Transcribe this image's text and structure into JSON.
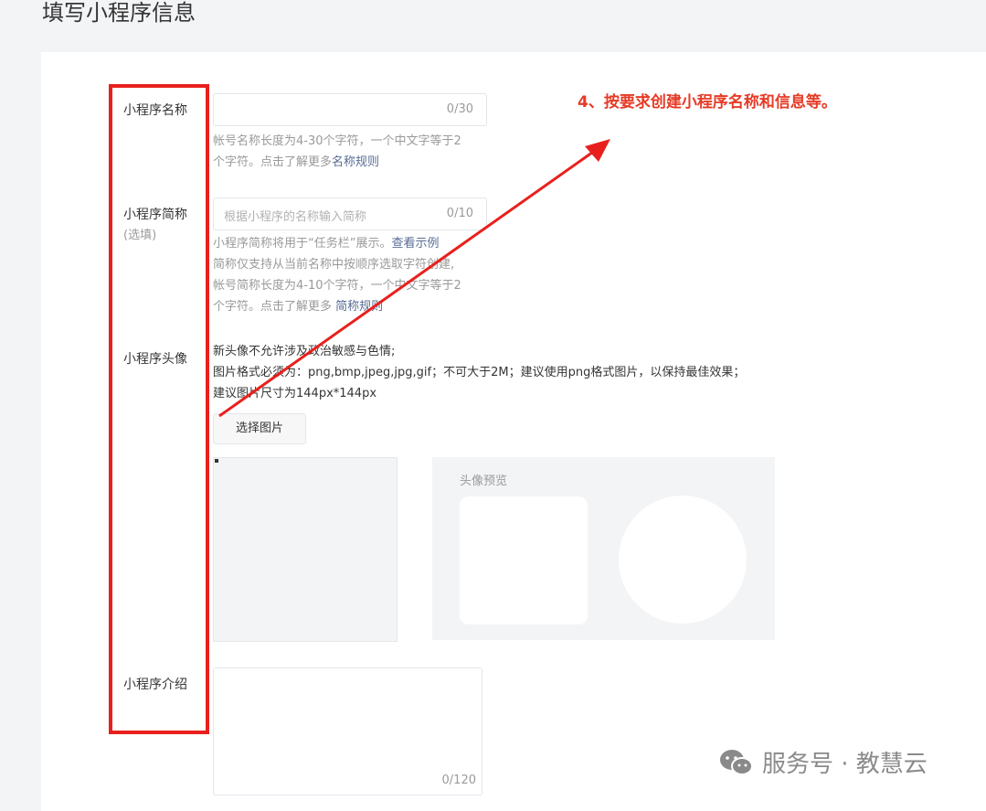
{
  "page": {
    "title": "填写小程序信息"
  },
  "form": {
    "name": {
      "label": "小程序名称",
      "counter": "0/30",
      "tip_text": "帐号名称长度为4-30个字符，一个中文字等于2个字符。点击了解更多",
      "tip_line1": "帐号名称长度为4-30个字符，一个中文字等于2",
      "tip_line2": "个字符。点击了解更多",
      "rule_link": "名称规则"
    },
    "short_name": {
      "label": "小程序简称",
      "optional": "(选填)",
      "placeholder": "根据小程序的名称输入简称",
      "counter": "0/10",
      "tip_line1": "小程序简称将用于“任务栏”展示。",
      "example_link": "查看示例",
      "tip_line2": "简称仅支持从当前名称中按顺序选取字符创建,",
      "tip_line3": "帐号简称长度为4-10个字符，一个中文字等于2",
      "tip_line4": "个字符。点击了解更多 ",
      "rule_link": "简称规则"
    },
    "avatar": {
      "label": "小程序头像",
      "desc_line1": "新头像不允许涉及政治敏感与色情;",
      "desc_line2": "图片格式必须为：png,bmp,jpeg,jpg,gif；不可大于2M；建议使用png格式图片，以保持最佳效果；",
      "desc_line3": "建议图片尺寸为144px*144px",
      "select_button": "选择图片",
      "preview_title": "头像预览"
    },
    "intro": {
      "label": "小程序介绍",
      "counter": "0/120"
    }
  },
  "annotation": {
    "text": "4、按要求创建小程序名称和信息等。",
    "color": "#e63b26",
    "box_color": "#e8201d"
  },
  "watermark": {
    "text": "服务号 · 教慧云",
    "icon": "wechat-icon"
  }
}
